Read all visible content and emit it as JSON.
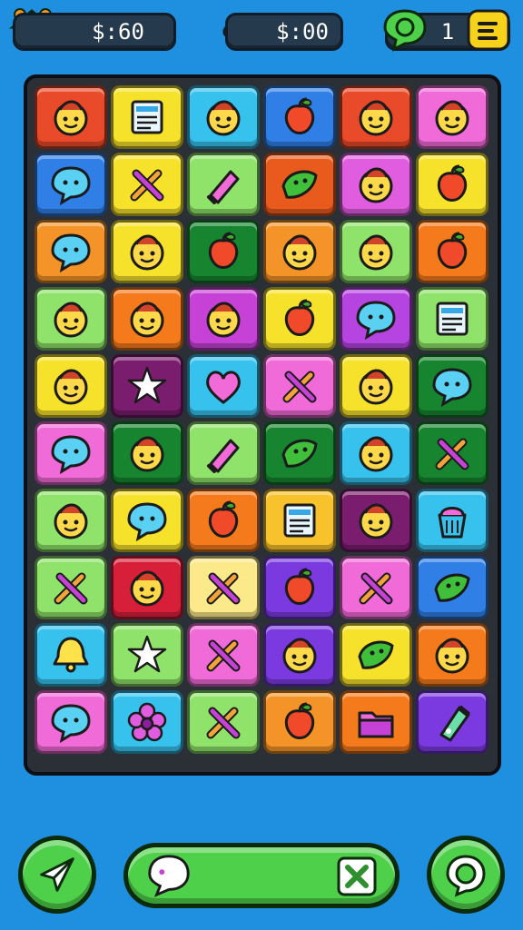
{
  "hud": {
    "cash": {
      "value": "$:60",
      "icon": "house-icon"
    },
    "gems": {
      "value": "$:00",
      "icon": "cloud-gem-icon"
    },
    "level": {
      "value": "1",
      "icon": "chat-bubble-icon",
      "menu_icon": "menu-icon"
    }
  },
  "board": {
    "rows": [
      [
        {
          "c": "#e84a2a",
          "i": "face"
        },
        {
          "c": "#f7e22b",
          "i": "book"
        },
        {
          "c": "#37c2ee",
          "i": "face"
        },
        {
          "c": "#2f7fe6",
          "i": "fruit"
        },
        {
          "c": "#e84a2a",
          "i": "face"
        },
        {
          "c": "#f06ad8",
          "i": "face"
        }
      ],
      [
        {
          "c": "#2f7fe6",
          "i": "bubble"
        },
        {
          "c": "#f7e22b",
          "i": "tools"
        },
        {
          "c": "#8fe26a",
          "i": "ruler"
        },
        {
          "c": "#e85b1c",
          "i": "leaf"
        },
        {
          "c": "#e05de0",
          "i": "face"
        },
        {
          "c": "#f7e22b",
          "i": "fruit"
        }
      ],
      [
        {
          "c": "#f49428",
          "i": "bubble"
        },
        {
          "c": "#f7e22b",
          "i": "face"
        },
        {
          "c": "#17852f",
          "i": "fruit"
        },
        {
          "c": "#f49428",
          "i": "face"
        },
        {
          "c": "#8fe26a",
          "i": "face"
        },
        {
          "c": "#f47a1c",
          "i": "fruit"
        }
      ],
      [
        {
          "c": "#8fe26a",
          "i": "face"
        },
        {
          "c": "#f47a1c",
          "i": "face"
        },
        {
          "c": "#c642d6",
          "i": "face"
        },
        {
          "c": "#f7e22b",
          "i": "fruit"
        },
        {
          "c": "#b544e0",
          "i": "bubble"
        },
        {
          "c": "#8fe26a",
          "i": "book"
        }
      ],
      [
        {
          "c": "#f7e22b",
          "i": "face"
        },
        {
          "c": "#7a1d6e",
          "i": "star"
        },
        {
          "c": "#37c2ee",
          "i": "heart"
        },
        {
          "c": "#f06ad8",
          "i": "tools"
        },
        {
          "c": "#f7e22b",
          "i": "face"
        },
        {
          "c": "#17852f",
          "i": "bubble"
        }
      ],
      [
        {
          "c": "#f06ad8",
          "i": "bubble"
        },
        {
          "c": "#17852f",
          "i": "face"
        },
        {
          "c": "#8fe26a",
          "i": "ruler"
        },
        {
          "c": "#17852f",
          "i": "leaf"
        },
        {
          "c": "#37c2ee",
          "i": "face"
        },
        {
          "c": "#17852f",
          "i": "tools"
        }
      ],
      [
        {
          "c": "#8fe26a",
          "i": "face"
        },
        {
          "c": "#f7e22b",
          "i": "bubble"
        },
        {
          "c": "#f47a1c",
          "i": "fruit"
        },
        {
          "c": "#f7c22b",
          "i": "book"
        },
        {
          "c": "#7a1d6e",
          "i": "face"
        },
        {
          "c": "#37c2ee",
          "i": "cup"
        }
      ],
      [
        {
          "c": "#8fe26a",
          "i": "tools"
        },
        {
          "c": "#d81f3a",
          "i": "face"
        },
        {
          "c": "#fbe98a",
          "i": "tools"
        },
        {
          "c": "#7a3ae0",
          "i": "fruit"
        },
        {
          "c": "#f06ad8",
          "i": "tools"
        },
        {
          "c": "#2f7fe6",
          "i": "leaf"
        }
      ],
      [
        {
          "c": "#37c2ee",
          "i": "bell"
        },
        {
          "c": "#8fe26a",
          "i": "star"
        },
        {
          "c": "#f06ad8",
          "i": "tools"
        },
        {
          "c": "#7a3ae0",
          "i": "face"
        },
        {
          "c": "#f7e22b",
          "i": "leaf"
        },
        {
          "c": "#f47a1c",
          "i": "face"
        }
      ],
      [
        {
          "c": "#f06ad8",
          "i": "bubble"
        },
        {
          "c": "#37c2ee",
          "i": "flower"
        },
        {
          "c": "#8fe26a",
          "i": "tools"
        },
        {
          "c": "#f49428",
          "i": "fruit"
        },
        {
          "c": "#f47a1c",
          "i": "folder"
        },
        {
          "c": "#7a3ae0",
          "i": "tube"
        }
      ]
    ]
  },
  "controls": {
    "left_button_icon": "paper-plane-icon",
    "chat_bubble_icon": "speech-bubble-icon",
    "close_icon": "close-icon",
    "right_button_icon": "search-bubble-icon"
  }
}
